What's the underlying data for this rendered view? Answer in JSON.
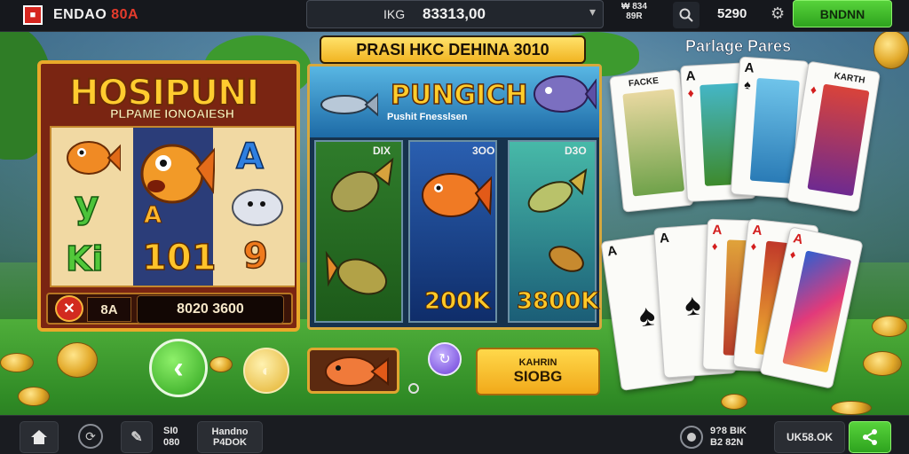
{
  "topbar": {
    "logo_badge": "■",
    "brand_main": "ENDAO",
    "brand_accent": "80A",
    "balance_label": "IKG",
    "balance_value": "83313,00",
    "mini_stat_top": "₩ 834",
    "mini_stat_bottom": "89R",
    "stake": "5290",
    "action_button": "BNDNN"
  },
  "slot_game": {
    "title": "HOSIPUNI",
    "subtitle": "PLPAME IONOAIESH",
    "symbols": [
      "A",
      "y",
      "Ki",
      "A",
      "101",
      "9"
    ],
    "bet": "8A",
    "credit": "8020 3600"
  },
  "fish_game": {
    "banner": "PRASI HKC DEHINA 3010",
    "logo": "PUNGICH",
    "logo_sub": "Pushit Fnesslsen",
    "columns": [
      {
        "tag": "DIX",
        "value": ""
      },
      {
        "tag": "3OO",
        "value": "200K"
      },
      {
        "tag": "D3O",
        "value": "3800K"
      }
    ]
  },
  "cards_panel": {
    "title": "Parlage Pares",
    "top_cards": [
      {
        "label": "FACKE",
        "corner": "",
        "suit": "spade"
      },
      {
        "label": "",
        "corner": "A",
        "suit": "diamond"
      },
      {
        "label": "",
        "corner": "A",
        "suit": "spade"
      },
      {
        "label": "KARTH",
        "corner": "",
        "suit": "diamond"
      }
    ],
    "bottom_cards": [
      {
        "corner": "A",
        "suit": "spade"
      },
      {
        "corner": "A",
        "suit": "spade"
      },
      {
        "corner": "A",
        "suit": "diamond"
      },
      {
        "corner": "A",
        "suit": "diamond"
      },
      {
        "corner": "A",
        "suit": "diamond"
      }
    ]
  },
  "controls": {
    "spin_label": "KAHRIN",
    "spin_value": "SIOBG"
  },
  "bottombar": {
    "stat1_top": "SI0",
    "stat1_bottom": "080",
    "pill_top": "Handno",
    "pill_bottom": "P4DOK",
    "counter": "9?8 BIK",
    "counter_sub": "B2 82N",
    "wallet": "UK58.OK"
  },
  "colors": {
    "accent_green": "#2ea31e",
    "accent_gold": "#f1b422",
    "brand_red": "#d6261f"
  }
}
